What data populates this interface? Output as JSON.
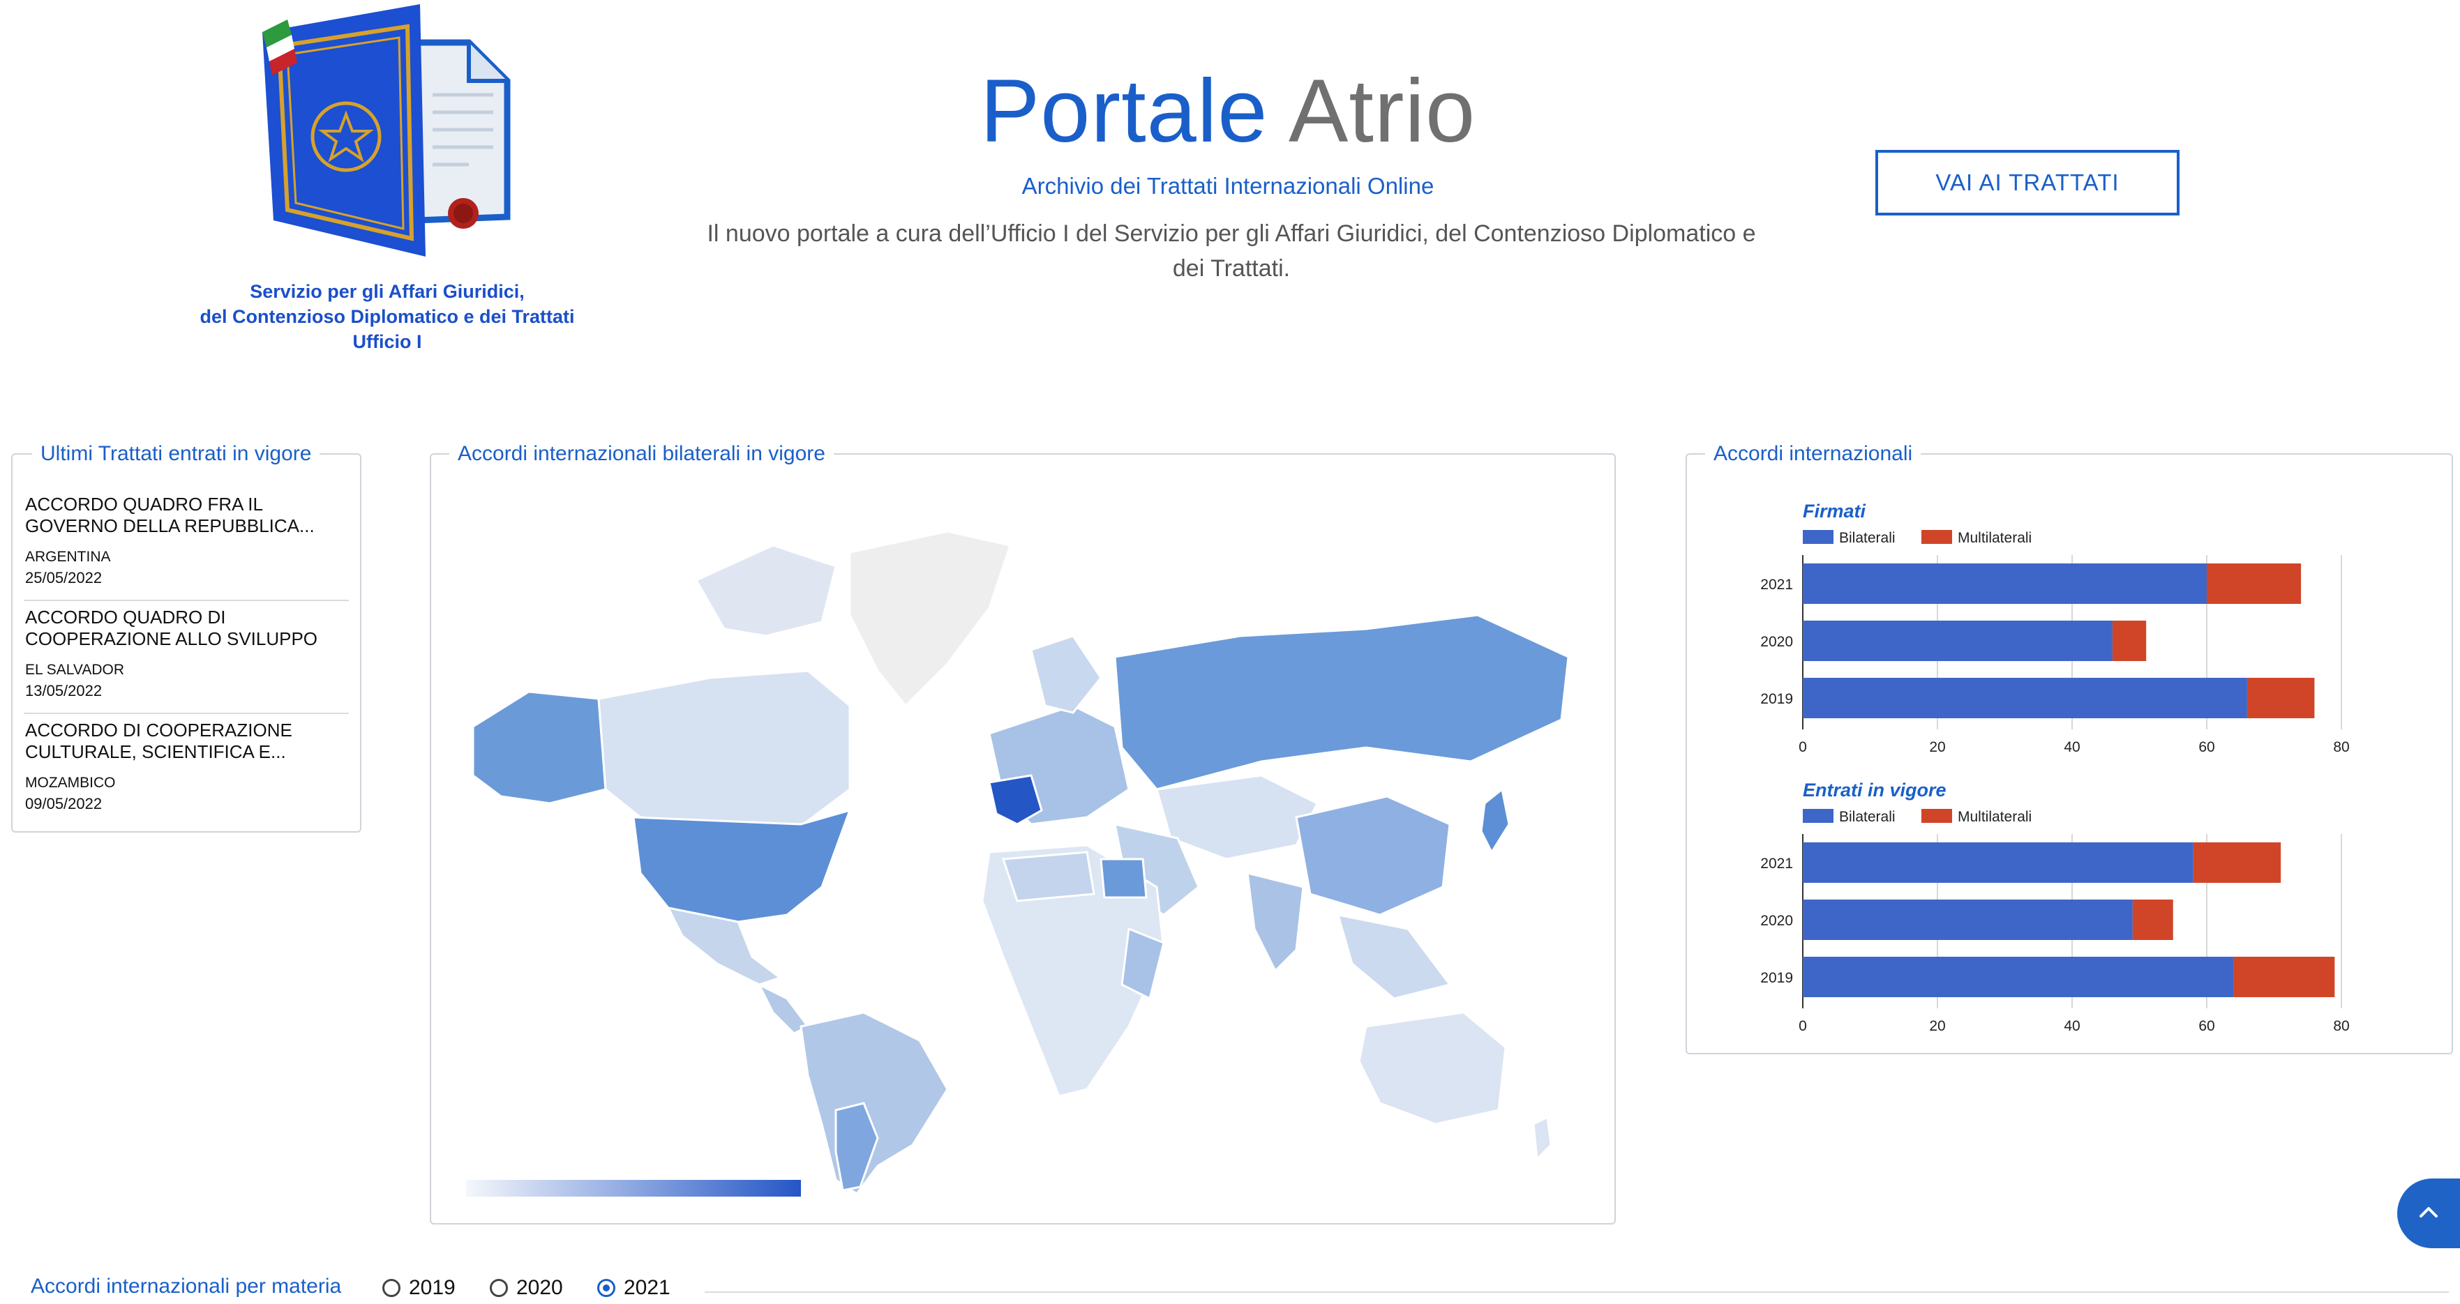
{
  "header": {
    "title_part1": "Portale",
    "title_part2": "Atrio",
    "subtitle": "Archivio dei Trattati Internazionali Online",
    "description": "Il nuovo portale a cura dell’Ufficio I del Servizio per gli Affari Giuridici, del Contenzioso Diplomatico e dei Trattati.",
    "logo_caption": [
      "Servizio per gli Affari Giuridici,",
      "del Contenzioso Diplomatico e dei Trattati",
      "Ufficio I"
    ],
    "cta_label": "VAI AI TRATTATI"
  },
  "treaties_panel": {
    "title": "Ultimi Trattati entrati in vigore",
    "items": [
      {
        "title": "ACCORDO QUADRO FRA IL GOVERNO DELLA REPUBBLICA...",
        "country": "ARGENTINA",
        "date": "25/05/2022"
      },
      {
        "title": "ACCORDO QUADRO DI COOPERAZIONE ALLO SVILUPPO",
        "country": "EL SALVADOR",
        "date": "13/05/2022"
      },
      {
        "title": "ACCORDO DI COOPERAZIONE CULTURALE, SCIENTIFICA E...",
        "country": "MOZAMBICO",
        "date": "09/05/2022"
      }
    ]
  },
  "map_panel": {
    "title": "Accordi internazionali bilaterali in vigore",
    "highlight_color": "#2456c6",
    "light_color": "#d6e2f2"
  },
  "bars_panel": {
    "title": "Accordi internazionali"
  },
  "chart_data": [
    {
      "type": "bar",
      "orientation": "horizontal",
      "stacked": true,
      "title": "Firmati",
      "categories": [
        "2021",
        "2020",
        "2019"
      ],
      "series": [
        {
          "name": "Bilaterali",
          "color": "#3d66c8",
          "values": [
            60,
            46,
            66
          ]
        },
        {
          "name": "Multilaterali",
          "color": "#d04527",
          "values": [
            14,
            5,
            10
          ]
        }
      ],
      "xlim": [
        0,
        80
      ],
      "xticks": [
        0,
        20,
        40,
        60,
        80
      ],
      "grid": true,
      "legend": "top-left"
    },
    {
      "type": "bar",
      "orientation": "horizontal",
      "stacked": true,
      "title": "Entrati in vigore",
      "categories": [
        "2021",
        "2020",
        "2019"
      ],
      "series": [
        {
          "name": "Bilaterali",
          "color": "#3d66c8",
          "values": [
            58,
            49,
            64
          ]
        },
        {
          "name": "Multilaterali",
          "color": "#d04527",
          "values": [
            13,
            6,
            15
          ]
        }
      ],
      "xlim": [
        0,
        80
      ],
      "xticks": [
        0,
        20,
        40,
        60,
        80
      ],
      "grid": true,
      "legend": "top-left"
    }
  ],
  "bottom": {
    "subject_title": "Accordi internazionali per materia",
    "years": [
      "2019",
      "2020",
      "2021"
    ],
    "selected_year": "2021"
  },
  "icons": {
    "back_to_top": "chevron-up-icon",
    "logo": "document-emblem-icon"
  }
}
